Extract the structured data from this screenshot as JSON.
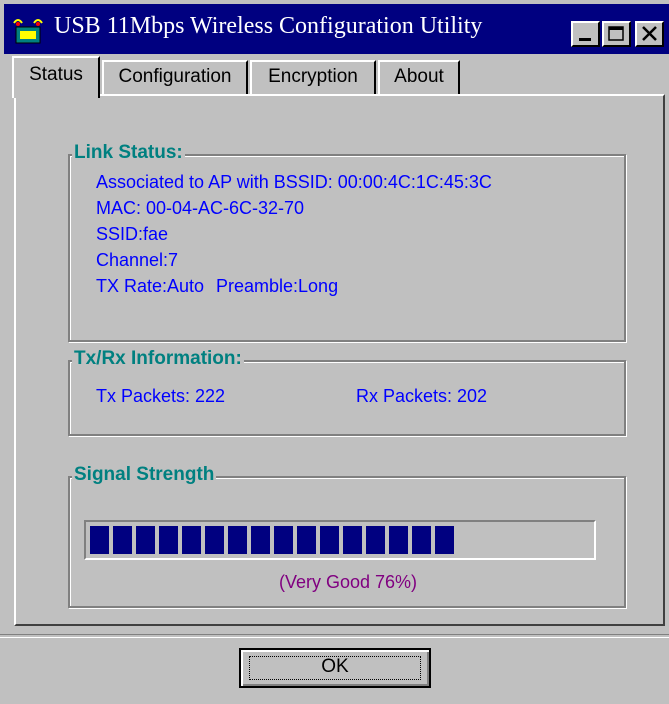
{
  "window": {
    "title": "USB 11Mbps Wireless Configuration Utility",
    "icon": "wireless-adapter-icon"
  },
  "title_buttons": [
    "minimize-icon",
    "maximize-icon",
    "close-icon"
  ],
  "tabs": [
    {
      "label": "Status",
      "active": true
    },
    {
      "label": "Configuration",
      "active": false
    },
    {
      "label": "Encryption",
      "active": false
    },
    {
      "label": "About",
      "active": false
    }
  ],
  "link_status": {
    "title": "Link Status:",
    "bssid_line": "Associated to AP with BSSID: 00:00:4C:1C:45:3C",
    "mac_line": "MAC: 00-04-AC-6C-32-70",
    "ssid_line": "SSID:fae",
    "channel_line": "Channel:7",
    "tx_rate": "TX Rate:Auto",
    "preamble": "Preamble:Long"
  },
  "txrx": {
    "title": "Tx/Rx Information:",
    "tx_packets": "Tx Packets: 222",
    "rx_packets": "Rx Packets: 202"
  },
  "signal": {
    "title": "Signal Strength",
    "level_percent": 76,
    "label": "(Very Good 76%)"
  },
  "ok_button": "OK",
  "colors": {
    "titlebar": "#000080",
    "group_title": "#008080",
    "info_text": "#0000ff",
    "meter_fill": "#000080",
    "signal_label": "#800080"
  }
}
